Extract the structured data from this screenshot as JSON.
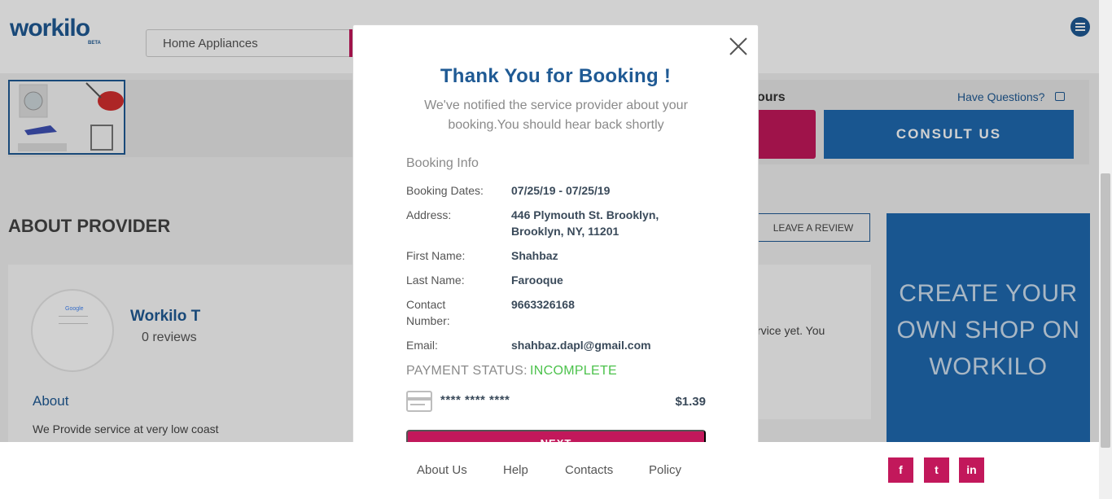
{
  "header": {
    "logo": "workilo",
    "logo_badge": "BETA",
    "search_value": "Home Appliances"
  },
  "booking_panel": {
    "hours_label": "ours",
    "have_questions": "Have Questions?",
    "consult_label": "CONSULT US"
  },
  "provider": {
    "section_title": "ABOUT PROVIDER",
    "leave_review": "LEAVE A REVIEW",
    "name": "Workilo T",
    "reviews": "0 reviews",
    "about_title": "About",
    "about_text": "We Provide service at very low coast",
    "avatar_brand": "Google",
    "reviews_fragment": "rvice yet. You"
  },
  "cta": {
    "text": "CREATE YOUR OWN SHOP ON WORKILO"
  },
  "modal": {
    "title": "Thank You for Booking !",
    "subtitle": "We've notified the service provider about your booking.You should hear back shortly",
    "section_title": "Booking Info",
    "rows": [
      {
        "label": "Booking Dates:",
        "value": "07/25/19 - 07/25/19"
      },
      {
        "label": "Address:",
        "value": "446 Plymouth St. Brooklyn, Brooklyn, NY, 11201"
      },
      {
        "label": "First Name:",
        "value": "Shahbaz"
      },
      {
        "label": "Last Name:",
        "value": "Farooque"
      },
      {
        "label": "Contact Number:",
        "value": "9663326168"
      },
      {
        "label": "Email:",
        "value": "shahbaz.dapl@gmail.com"
      }
    ],
    "payment_label": "PAYMENT STATUS:",
    "payment_status": "INCOMPLETE",
    "card_number": "**** **** ****",
    "amount": "$1.39",
    "next_label": "NEXT"
  },
  "footer": {
    "links": [
      "About Us",
      "Help",
      "Contacts",
      "Policy"
    ],
    "social": [
      "f",
      "t",
      "in"
    ]
  },
  "colors": {
    "brand_blue": "#1f5a94",
    "accent_pink": "#c2185b",
    "status_green": "#4cc24c"
  }
}
